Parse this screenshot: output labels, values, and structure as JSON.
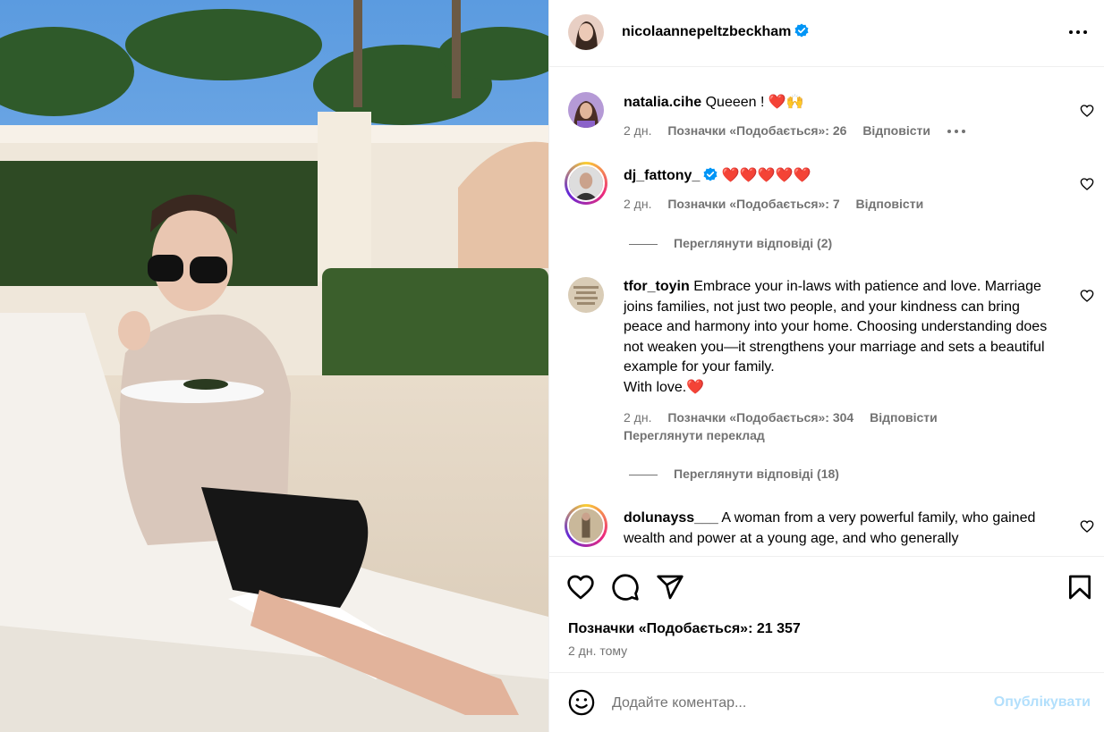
{
  "post": {
    "author": "nicolaannepeltzbeckham",
    "verified": true
  },
  "comments": [
    {
      "username": "natalia.cihe",
      "text": "Queeen ! ❤️🙌",
      "age": "2 дн.",
      "likes": "Позначки «Подобається»: 26",
      "reply": "Відповісти"
    },
    {
      "username": "dj_fattony_",
      "verified": true,
      "text": "❤️❤️❤️❤️❤️",
      "age": "2 дн.",
      "likes": "Позначки «Подобається»: 7",
      "reply": "Відповісти",
      "view_replies": "Переглянути відповіді (2)"
    },
    {
      "username": "tfor_toyin",
      "text": "Embrace your in-laws with patience and love. Marriage joins families, not just two people, and your kindness can bring peace and harmony into your home. Choosing understanding does not weaken you—it strengthens your marriage and sets a beautiful example for your family.",
      "text2": "With love.❤️",
      "age": "2 дн.",
      "likes": "Позначки «Подобається»: 304",
      "reply": "Відповісти",
      "see_translation": "Переглянути переклад",
      "view_replies": "Переглянути відповіді (18)"
    },
    {
      "username": "dolunayss___",
      "text": "A woman from a very powerful family, who gained wealth and power at a young age, and who generally"
    }
  ],
  "footer": {
    "likes": "Позначки «Подобається»: 21 357",
    "time": "2 дн. тому",
    "comment_placeholder": "Додайте коментар...",
    "post_label": "Опублікувати"
  },
  "colors": {
    "verified": "#0095f6",
    "muted": "#737373",
    "post_button_disabled": "#b2dffc",
    "divider": "#efefef"
  },
  "icons": [
    "verified-icon",
    "more-icon",
    "heart-icon",
    "comment-icon",
    "share-icon",
    "bookmark-icon",
    "emoji-icon"
  ]
}
